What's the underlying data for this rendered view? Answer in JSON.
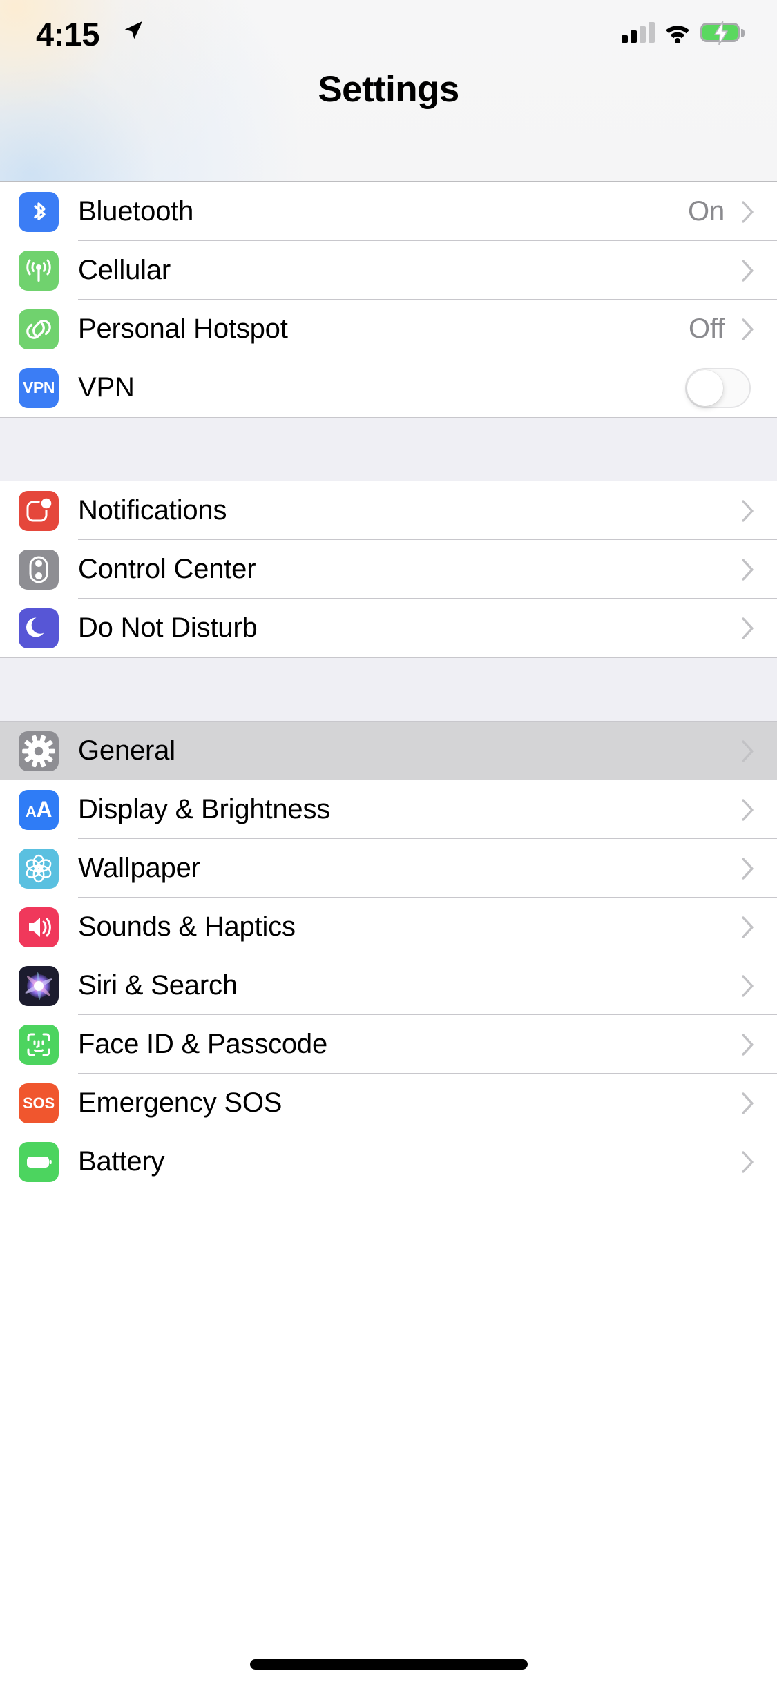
{
  "status_bar": {
    "time": "4:15",
    "location_icon": "location-arrow-icon",
    "signal_icon": "cellular-signal-icon",
    "signal_bars_filled": 2,
    "signal_bars_total": 4,
    "wifi_icon": "wifi-icon",
    "battery_icon": "battery-charging-icon",
    "battery_charging": true,
    "battery_color": "#5ad85f"
  },
  "header": {
    "title": "Settings"
  },
  "colors": {
    "separator": "#c8c7cc",
    "group_gap": "#efeff4",
    "selected_row": "#d4d4d6",
    "secondary_text": "#8a8a8e",
    "chevron": "#c4c4c6"
  },
  "groups": [
    {
      "rows": [
        {
          "label": "Bluetooth",
          "value": "On",
          "icon": "bluetooth-icon",
          "icon_color": "#3b7df5",
          "accessory": "chevron",
          "selected": false
        },
        {
          "label": "Cellular",
          "value": "",
          "icon": "cellular-antenna-icon",
          "icon_color": "#70d26e",
          "accessory": "chevron",
          "selected": false
        },
        {
          "label": "Personal Hotspot",
          "value": "Off",
          "icon": "personal-hotspot-icon",
          "icon_color": "#70d26e",
          "accessory": "chevron",
          "selected": false
        },
        {
          "label": "VPN",
          "value": "",
          "icon": "vpn-icon",
          "icon_color": "#3b7df5",
          "icon_text": "VPN",
          "accessory": "toggle",
          "toggle_on": false,
          "selected": false
        }
      ]
    },
    {
      "rows": [
        {
          "label": "Notifications",
          "value": "",
          "icon": "notifications-icon",
          "icon_color": "#e5473b",
          "accessory": "chevron",
          "selected": false
        },
        {
          "label": "Control Center",
          "value": "",
          "icon": "control-center-icon",
          "icon_color": "#8e8e93",
          "accessory": "chevron",
          "selected": false
        },
        {
          "label": "Do Not Disturb",
          "value": "",
          "icon": "do-not-disturb-icon",
          "icon_color": "#5756d6",
          "accessory": "chevron",
          "selected": false
        }
      ]
    },
    {
      "rows": [
        {
          "label": "General",
          "value": "",
          "icon": "gear-icon",
          "icon_color": "#8e8e93",
          "accessory": "chevron",
          "selected": true
        },
        {
          "label": "Display & Brightness",
          "value": "",
          "icon": "display-brightness-icon",
          "icon_color": "#2f7cf6",
          "icon_text": "AA",
          "accessory": "chevron",
          "selected": false
        },
        {
          "label": "Wallpaper",
          "value": "",
          "icon": "wallpaper-icon",
          "icon_color": "#5ac0e0",
          "accessory": "chevron",
          "selected": false
        },
        {
          "label": "Sounds & Haptics",
          "value": "",
          "icon": "sounds-haptics-icon",
          "icon_color": "#f0385b",
          "accessory": "chevron",
          "selected": false
        },
        {
          "label": "Siri & Search",
          "value": "",
          "icon": "siri-search-icon",
          "icon_color": "#1c1c2e",
          "accessory": "chevron",
          "selected": false
        },
        {
          "label": "Face ID & Passcode",
          "value": "",
          "icon": "face-id-icon",
          "icon_color": "#4cd45f",
          "accessory": "chevron",
          "selected": false
        },
        {
          "label": "Emergency SOS",
          "value": "",
          "icon": "emergency-sos-icon",
          "icon_color": "#f0562e",
          "icon_text": "SOS",
          "accessory": "chevron",
          "selected": false
        },
        {
          "label": "Battery",
          "value": "",
          "icon": "battery-icon",
          "icon_color": "#4cd45f",
          "accessory": "chevron",
          "selected": false
        }
      ]
    }
  ],
  "home_indicator": "home-indicator"
}
